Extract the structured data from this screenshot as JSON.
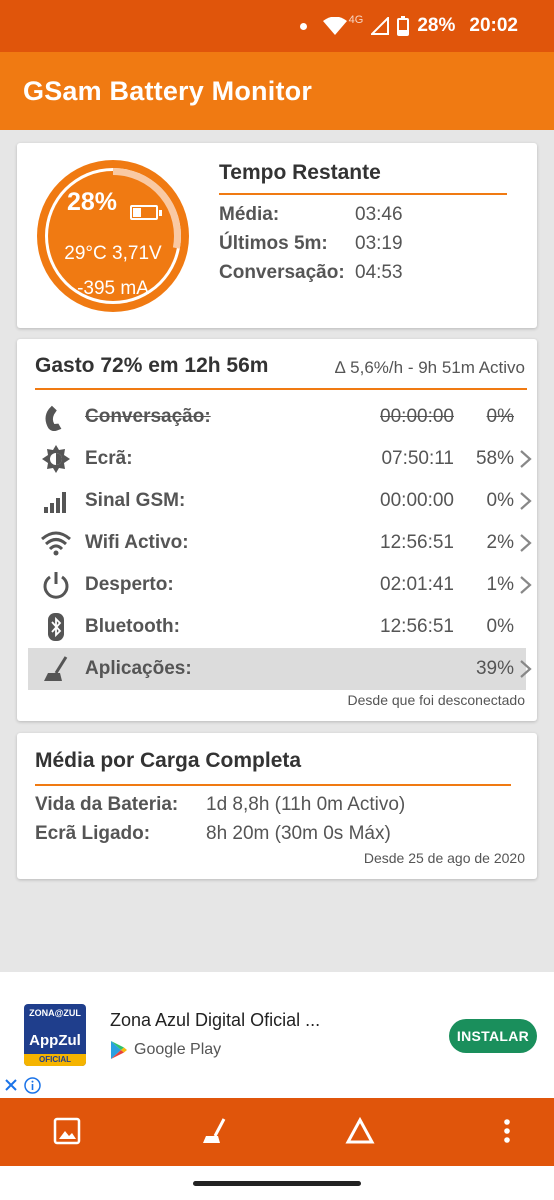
{
  "status_bar": {
    "network": "4G",
    "battery": "28%",
    "time": "20:02"
  },
  "app": {
    "title": "GSam Battery Monitor"
  },
  "gauge": {
    "percent": "28%",
    "level": 0.28,
    "temp_volt": "29°C  3,71V",
    "current": "-395 mA"
  },
  "time_left": {
    "title": "Tempo Restante",
    "rows": [
      {
        "label": "Média:",
        "value": "03:46"
      },
      {
        "label": "Últimos 5m:",
        "value": "03:19"
      },
      {
        "label": "Conversação:",
        "value": "04:53"
      }
    ]
  },
  "usage": {
    "title": "Gasto 72% em 12h 56m",
    "rate": "∆ 5,6%/h - 9h 51m Activo",
    "rows": [
      {
        "icon": "phone-icon",
        "label": "Conversação:",
        "time": "00:00:00",
        "pct": "0%"
      },
      {
        "icon": "screen-brightness-icon",
        "label": "Ecrã:",
        "time": "07:50:11",
        "pct": "58%"
      },
      {
        "icon": "signal-bars-icon",
        "label": "Sinal GSM:",
        "time": "00:00:00",
        "pct": "0%"
      },
      {
        "icon": "wifi-icon",
        "label": "Wifi Activo:",
        "time": "12:56:51",
        "pct": "2%"
      },
      {
        "icon": "power-icon",
        "label": "Desperto:",
        "time": "02:01:41",
        "pct": "1%"
      },
      {
        "icon": "bluetooth-icon",
        "label": "Bluetooth:",
        "time": "12:56:51",
        "pct": "0%"
      },
      {
        "icon": "broom-icon",
        "label": "Aplicações:",
        "time": "",
        "pct": "39%"
      }
    ],
    "footer": "Desde que foi desconectado"
  },
  "average": {
    "title": "Média por Carga Completa",
    "rows": [
      {
        "label": "Vida da Bateria:",
        "value": "1d 8,8h (11h 0m Activo)"
      },
      {
        "label": "Ecrã Ligado:",
        "value": "8h 20m (30m 0s Máx)"
      }
    ],
    "footer": "Desde 25 de ago de 2020"
  },
  "ad": {
    "logo_top": "ZONA@ZUL",
    "logo_mid": "AppZul",
    "logo_bottom": "OFICIAL",
    "title": "Zona Azul Digital Oficial ...",
    "store": "Google Play",
    "install": "INSTALAR"
  },
  "colors": {
    "status_bar": "#e0550b",
    "app_bar": "#f07a12",
    "accent": "#f07a12",
    "install": "#1a8f5c"
  }
}
